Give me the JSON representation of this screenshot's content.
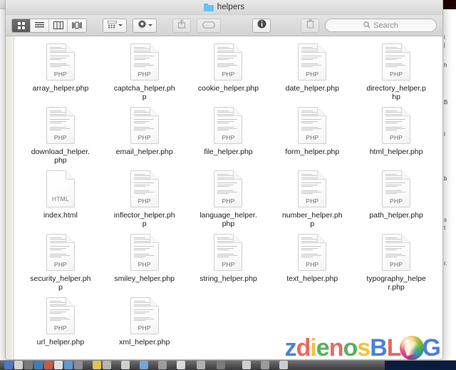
{
  "window": {
    "title": "helpers",
    "folder_icon": "folder-icon"
  },
  "toolbar": {
    "view_icon_label": "icon-view-icon",
    "view_list_label": "list-view-icon",
    "view_column_label": "column-view-icon",
    "view_coverflow_label": "coverflow-view-icon",
    "arrange_label": "arrange-icon",
    "action_label": "gear-icon",
    "share_label": "share-icon",
    "tag_label": "tag-icon",
    "info_label": "info-icon",
    "delete_label": "trash-icon",
    "search_placeholder": "Search",
    "search_value": "",
    "search_icon": "search-icon"
  },
  "files": [
    {
      "name": "array_helper.php",
      "kind": "PHP",
      "type": "php"
    },
    {
      "name": "captcha_helper.php",
      "kind": "PHP",
      "type": "php"
    },
    {
      "name": "cookie_helper.php",
      "kind": "PHP",
      "type": "php"
    },
    {
      "name": "date_helper.php",
      "kind": "PHP",
      "type": "php"
    },
    {
      "name": "directory_helper.php",
      "kind": "PHP",
      "type": "php"
    },
    {
      "name": "download_helper.php",
      "kind": "PHP",
      "type": "php"
    },
    {
      "name": "email_helper.php",
      "kind": "PHP",
      "type": "php"
    },
    {
      "name": "file_helper.php",
      "kind": "PHP",
      "type": "php"
    },
    {
      "name": "form_helper.php",
      "kind": "PHP",
      "type": "php"
    },
    {
      "name": "html_helper.php",
      "kind": "PHP",
      "type": "php"
    },
    {
      "name": "index.html",
      "kind": "HTML",
      "type": "html"
    },
    {
      "name": "inflector_helper.php",
      "kind": "PHP",
      "type": "php"
    },
    {
      "name": "language_helper.php",
      "kind": "PHP",
      "type": "php"
    },
    {
      "name": "number_helper.php",
      "kind": "PHP",
      "type": "php"
    },
    {
      "name": "path_helper.php",
      "kind": "PHP",
      "type": "php"
    },
    {
      "name": "security_helper.php",
      "kind": "PHP",
      "type": "php"
    },
    {
      "name": "smiley_helper.php",
      "kind": "PHP",
      "type": "php"
    },
    {
      "name": "string_helper.php",
      "kind": "PHP",
      "type": "php"
    },
    {
      "name": "text_helper.php",
      "kind": "PHP",
      "type": "php"
    },
    {
      "name": "typography_helper.php",
      "kind": "PHP",
      "type": "php"
    },
    {
      "name": "url_helper.php",
      "kind": "PHP",
      "type": "php"
    },
    {
      "name": "xml_helper.php",
      "kind": "PHP",
      "type": "php"
    }
  ],
  "watermark": {
    "letters": [
      {
        "ch": "z",
        "color": "#4a7fe0"
      },
      {
        "ch": "d",
        "color": "#e8695e"
      },
      {
        "ch": "i",
        "color": "#f2c03c"
      },
      {
        "ch": "e",
        "color": "#57b05c"
      },
      {
        "ch": "n",
        "color": "#e8695e"
      },
      {
        "ch": "o",
        "color": "#57b05c"
      },
      {
        "ch": "s",
        "color": "#f2c03c"
      },
      {
        "ch": "B",
        "color": "#4a7fe0"
      },
      {
        "ch": "L",
        "color": "#e8695e"
      }
    ],
    "globe": "globe-logo",
    "tail": {
      "ch": "G",
      "color": "#4a7fe0"
    }
  },
  "background": {
    "right_text": [
      "i",
      "j",
      "h",
      "B",
      "l",
      "b",
      "s",
      "t",
      "r."
    ]
  }
}
